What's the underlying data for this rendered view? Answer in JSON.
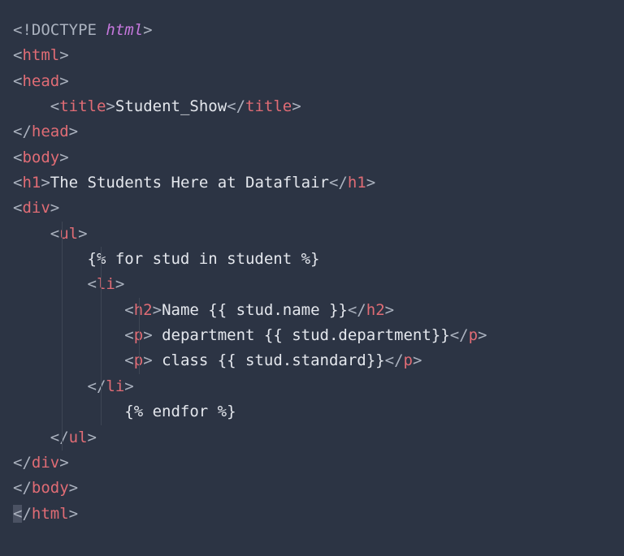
{
  "code": {
    "lines": [
      {
        "indent": 0,
        "tokens": [
          {
            "t": "tag-bracket",
            "v": "<!"
          },
          {
            "t": "doctype-kw",
            "v": "DOCTYPE "
          },
          {
            "t": "doctype-html",
            "v": "html"
          },
          {
            "t": "tag-bracket",
            "v": ">"
          }
        ]
      },
      {
        "indent": 0,
        "tokens": [
          {
            "t": "tag-bracket",
            "v": "<"
          },
          {
            "t": "tag-name",
            "v": "html"
          },
          {
            "t": "tag-bracket",
            "v": ">"
          }
        ]
      },
      {
        "indent": 0,
        "tokens": [
          {
            "t": "tag-bracket",
            "v": "<"
          },
          {
            "t": "tag-name",
            "v": "head"
          },
          {
            "t": "tag-bracket",
            "v": ">"
          }
        ]
      },
      {
        "indent": 1,
        "tokens": [
          {
            "t": "tag-bracket",
            "v": "<"
          },
          {
            "t": "tag-name",
            "v": "title"
          },
          {
            "t": "tag-bracket",
            "v": ">"
          },
          {
            "t": "text",
            "v": "Student_Show"
          },
          {
            "t": "tag-bracket",
            "v": "</"
          },
          {
            "t": "tag-name",
            "v": "title"
          },
          {
            "t": "tag-bracket",
            "v": ">"
          }
        ]
      },
      {
        "indent": 0,
        "tokens": [
          {
            "t": "tag-bracket",
            "v": "</"
          },
          {
            "t": "tag-name",
            "v": "head"
          },
          {
            "t": "tag-bracket",
            "v": ">"
          }
        ]
      },
      {
        "indent": 0,
        "tokens": [
          {
            "t": "tag-bracket",
            "v": "<"
          },
          {
            "t": "tag-name",
            "v": "body"
          },
          {
            "t": "tag-bracket",
            "v": ">"
          }
        ]
      },
      {
        "indent": 0,
        "tokens": [
          {
            "t": "tag-bracket",
            "v": "<"
          },
          {
            "t": "tag-name",
            "v": "h1"
          },
          {
            "t": "tag-bracket",
            "v": ">"
          },
          {
            "t": "text",
            "v": "The Students Here at Dataflair"
          },
          {
            "t": "tag-bracket",
            "v": "</"
          },
          {
            "t": "tag-name",
            "v": "h1"
          },
          {
            "t": "tag-bracket",
            "v": ">"
          }
        ]
      },
      {
        "indent": 0,
        "tokens": [
          {
            "t": "tag-bracket",
            "v": "<"
          },
          {
            "t": "tag-name",
            "v": "div"
          },
          {
            "t": "tag-bracket",
            "v": ">"
          }
        ]
      },
      {
        "indent": 1,
        "guides": [
          1
        ],
        "tokens": [
          {
            "t": "tag-bracket",
            "v": "<"
          },
          {
            "t": "tag-name",
            "v": "ul"
          },
          {
            "t": "tag-bracket",
            "v": ">"
          }
        ]
      },
      {
        "indent": 2,
        "guides": [
          1,
          2
        ],
        "tokens": [
          {
            "t": "template",
            "v": "{% for stud in student %}"
          }
        ]
      },
      {
        "indent": 2,
        "guides": [
          1,
          2
        ],
        "tokens": [
          {
            "t": "tag-bracket",
            "v": "<"
          },
          {
            "t": "tag-name",
            "v": "li"
          },
          {
            "t": "tag-bracket",
            "v": ">"
          }
        ]
      },
      {
        "indent": 3,
        "guides": [
          1,
          2,
          3
        ],
        "tokens": [
          {
            "t": "tag-bracket",
            "v": "<"
          },
          {
            "t": "tag-name",
            "v": "h2"
          },
          {
            "t": "tag-bracket",
            "v": ">"
          },
          {
            "t": "text",
            "v": "Name {{ stud.name }}"
          },
          {
            "t": "tag-bracket",
            "v": "</"
          },
          {
            "t": "tag-name",
            "v": "h2"
          },
          {
            "t": "tag-bracket",
            "v": ">"
          }
        ]
      },
      {
        "indent": 3,
        "guides": [
          1,
          2,
          3
        ],
        "tokens": [
          {
            "t": "tag-bracket",
            "v": "<"
          },
          {
            "t": "tag-name",
            "v": "p"
          },
          {
            "t": "tag-bracket",
            "v": ">"
          },
          {
            "t": "text",
            "v": " department {{ stud.department}}"
          },
          {
            "t": "tag-bracket",
            "v": "</"
          },
          {
            "t": "tag-name",
            "v": "p"
          },
          {
            "t": "tag-bracket",
            "v": ">"
          }
        ]
      },
      {
        "indent": 3,
        "guides": [
          1,
          2,
          3
        ],
        "tokens": [
          {
            "t": "tag-bracket",
            "v": "<"
          },
          {
            "t": "tag-name",
            "v": "p"
          },
          {
            "t": "tag-bracket",
            "v": ">"
          },
          {
            "t": "text",
            "v": " class {{ stud.standard}}"
          },
          {
            "t": "tag-bracket",
            "v": "</"
          },
          {
            "t": "tag-name",
            "v": "p"
          },
          {
            "t": "tag-bracket",
            "v": ">"
          }
        ]
      },
      {
        "indent": 2,
        "guides": [
          1,
          2
        ],
        "tokens": [
          {
            "t": "tag-bracket",
            "v": "</"
          },
          {
            "t": "tag-name",
            "v": "li"
          },
          {
            "t": "tag-bracket",
            "v": ">"
          }
        ]
      },
      {
        "indent": 3,
        "guides": [
          1,
          2
        ],
        "tokens": [
          {
            "t": "template",
            "v": "{% endfor %}"
          }
        ]
      },
      {
        "indent": 1,
        "guides": [
          1
        ],
        "tokens": [
          {
            "t": "tag-bracket",
            "v": "</"
          },
          {
            "t": "tag-name",
            "v": "ul"
          },
          {
            "t": "tag-bracket",
            "v": ">"
          }
        ]
      },
      {
        "indent": 0,
        "tokens": [
          {
            "t": "tag-bracket",
            "v": "</"
          },
          {
            "t": "tag-name",
            "v": "div"
          },
          {
            "t": "tag-bracket",
            "v": ">"
          }
        ]
      },
      {
        "indent": 0,
        "tokens": [
          {
            "t": "tag-bracket",
            "v": "</"
          },
          {
            "t": "tag-name",
            "v": "body"
          },
          {
            "t": "tag-bracket",
            "v": ">"
          }
        ]
      },
      {
        "indent": 0,
        "cursor": true,
        "tokens": [
          {
            "t": "tag-bracket",
            "v": "</"
          },
          {
            "t": "tag-name",
            "v": "html"
          },
          {
            "t": "tag-bracket",
            "v": ">"
          }
        ]
      }
    ],
    "indent_unit": "    "
  }
}
